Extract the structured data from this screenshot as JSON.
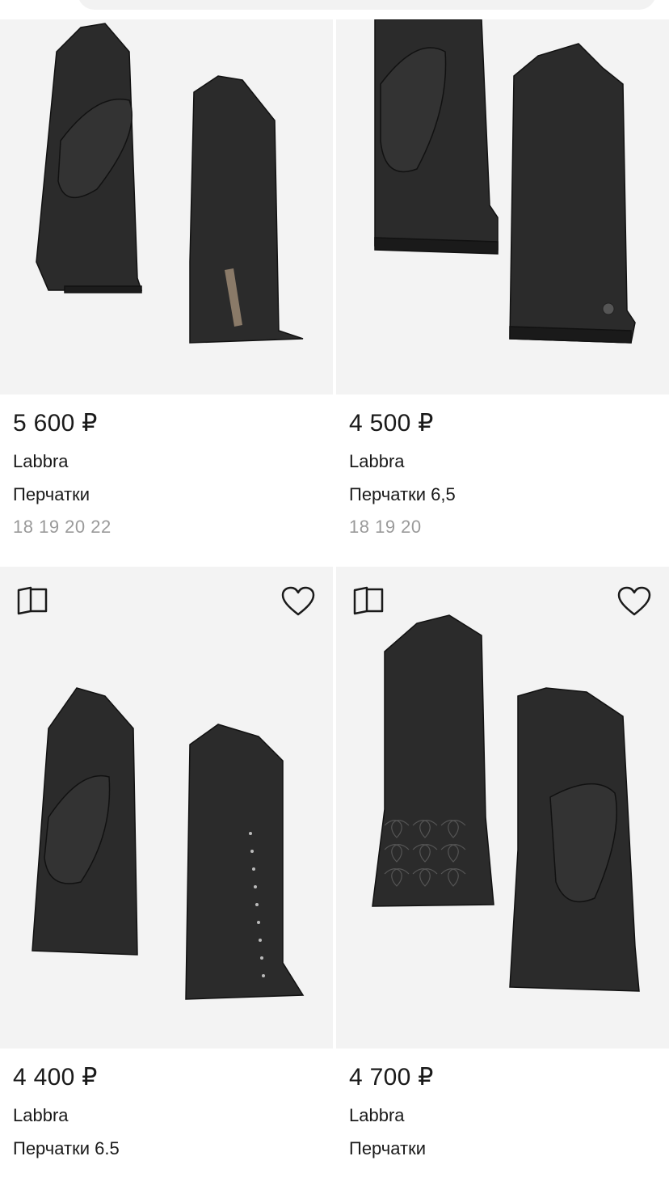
{
  "products": [
    {
      "price": "5 600 ₽",
      "brand": "Labbra",
      "name": "Перчатки",
      "sizes": "18 19 20 22"
    },
    {
      "price": "4 500 ₽",
      "brand": "Labbra",
      "name": "Перчатки 6,5",
      "sizes": "18 19 20"
    },
    {
      "price": "4 400 ₽",
      "brand": "Labbra",
      "name": "Перчатки 6.5",
      "sizes": "",
      "compare_icon": "compare-icon",
      "favorite_icon": "heart-icon"
    },
    {
      "price": "4 700 ₽",
      "brand": "Labbra",
      "name": "Перчатки",
      "sizes": "",
      "compare_icon": "compare-icon",
      "favorite_icon": "heart-icon"
    }
  ],
  "colors": {
    "image_bg": "#f3f3f3",
    "glove": "#2b2b2b",
    "sizes_text": "#9a9a9a"
  }
}
